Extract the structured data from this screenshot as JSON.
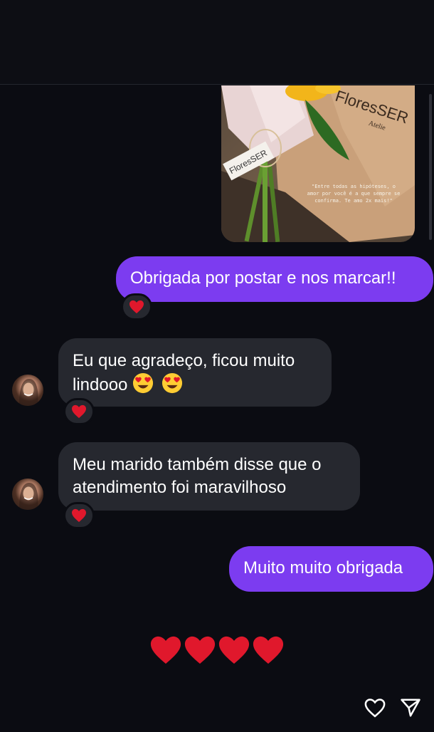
{
  "shared_story": {
    "brand_text": "FloresSER",
    "brand_subtext": "Atelie",
    "tag_text": "FloresSER",
    "note_text": [
      "\"Entre todas as hipóteses, o",
      "amor por você é a que sempre se",
      "confirma. Te amo 2x mais!\""
    ]
  },
  "messages": [
    {
      "id": "m1",
      "direction": "outgoing",
      "text": "Obrigada por postar e nos marcar!!",
      "reaction": "red-heart"
    },
    {
      "id": "m2",
      "direction": "incoming",
      "lines": [
        "Eu que agradeço, ficou muito",
        "lindooo"
      ],
      "emojis": [
        "heart-eyes",
        "heart-eyes"
      ],
      "reaction": "red-heart"
    },
    {
      "id": "m3",
      "direction": "incoming",
      "lines": [
        "Meu marido também disse que o",
        "atendimento foi maravilhoso"
      ],
      "reaction": "red-heart"
    },
    {
      "id": "m4",
      "direction": "outgoing",
      "text": "Muito muito obrigada"
    }
  ],
  "hearts_row": [
    "red-heart",
    "red-heart",
    "red-heart",
    "red-heart"
  ],
  "footer": {
    "like_icon": "heart-outline-icon",
    "send_icon": "paper-plane-icon"
  },
  "colors": {
    "background": "#0b0c12",
    "outgoing_bubble": "#7c3cf0",
    "incoming_bubble": "#26282f",
    "heart": "#e0182c"
  }
}
